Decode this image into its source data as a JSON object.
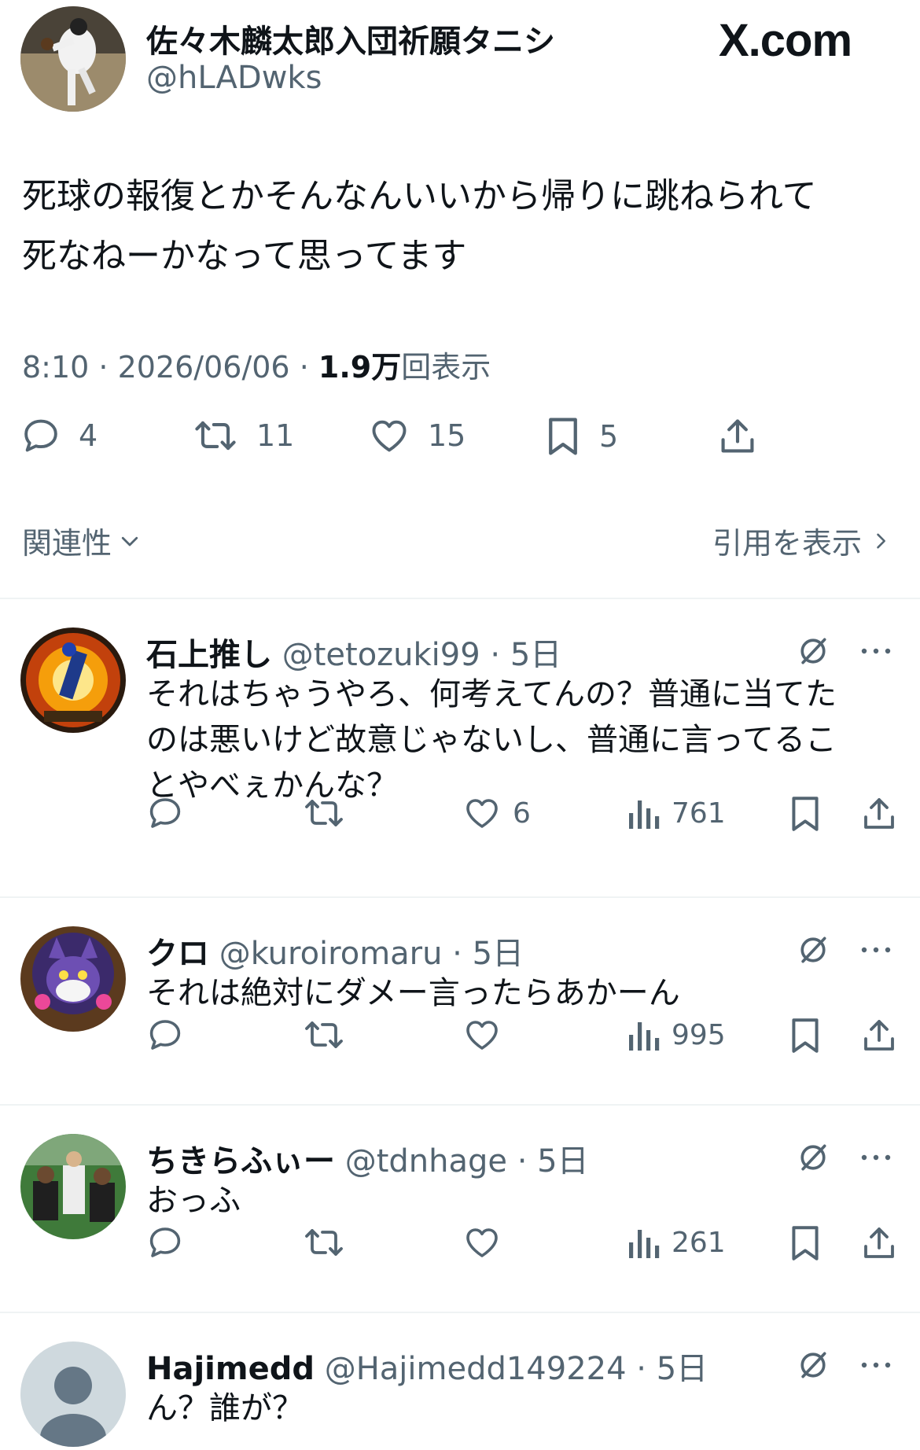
{
  "header": {
    "display_name": "佐々木麟太郎入団祈願タニシ",
    "handle": "@hLADwks",
    "brand": "X.com"
  },
  "tweet": {
    "line1": "死球の報復とかそんなんいいから帰りに跳ねられて",
    "line2": "死なねーかなって思ってます",
    "time": "8:10",
    "sep": " · ",
    "date": "2026/06/06",
    "views_number": "1.9万",
    "views_label": "回表示",
    "counts": {
      "replies": "4",
      "reposts": "11",
      "likes": "15",
      "bookmarks": "5"
    }
  },
  "sort": {
    "left_label": "関連性",
    "right_label": "引用を表示"
  },
  "replies": [
    {
      "name": "石上推し",
      "handle": "@tetozuki99",
      "age": "5日",
      "lines": [
        "それはちゃうやろ、何考えてんの？普通に当てた",
        "のは悪いけど故意じゃないし、普通に言ってるこ",
        "とやべぇかんな？"
      ],
      "likes": "6",
      "views": "761"
    },
    {
      "name": "クロ",
      "handle": "@kuroiromaru",
      "age": "5日",
      "lines": [
        "それは絶対にダメー言ったらあかーん"
      ],
      "likes": "",
      "views": "995"
    },
    {
      "name": "ちきらふぃー",
      "handle": "@tdnhage",
      "age": "5日",
      "lines": [
        "おっふ"
      ],
      "likes": "",
      "views": "261"
    },
    {
      "name": "Hajimedd",
      "handle": "@Hajimedd149224",
      "age": "5日",
      "lines": [
        "ん？誰が？"
      ],
      "likes": "",
      "views": ""
    }
  ],
  "colors": {
    "text": "#0f1419",
    "muted": "#536471",
    "divider": "#eff3f4"
  }
}
